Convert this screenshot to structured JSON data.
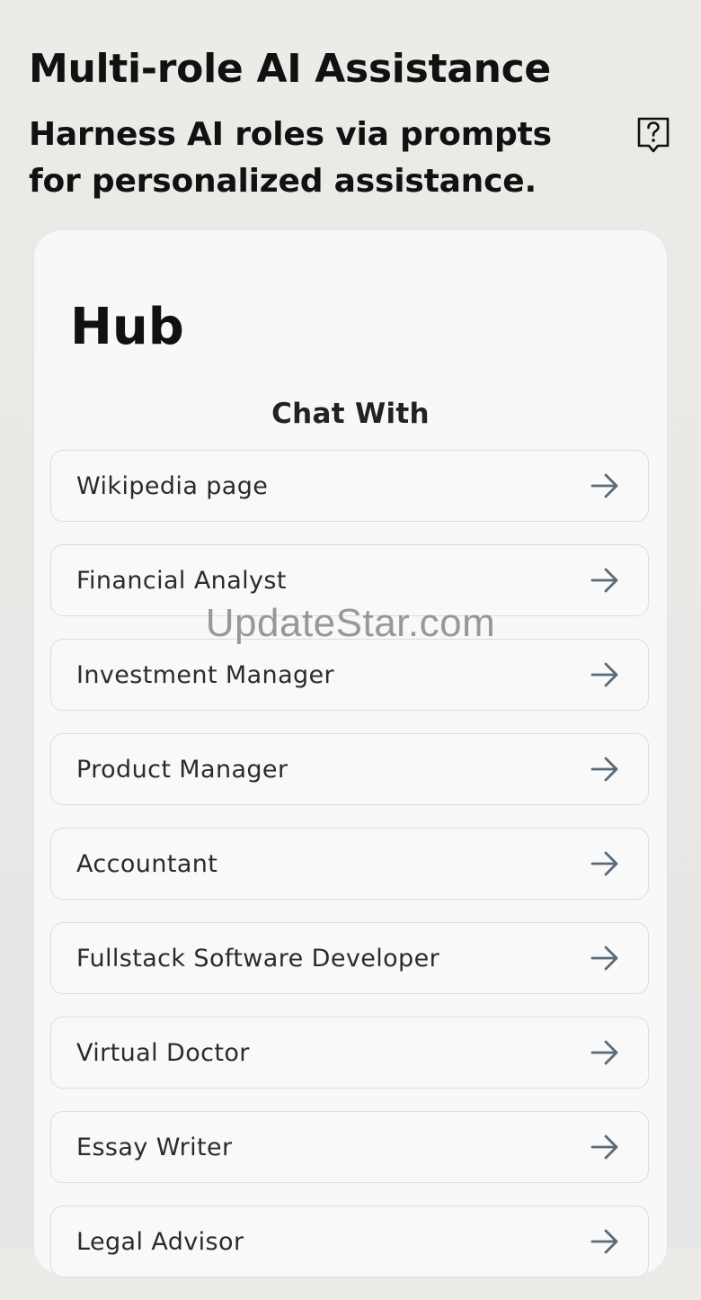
{
  "header": {
    "title": "Multi-role AI Assistance",
    "subtitle": "Harness AI roles via prompts for personalized assistance.",
    "help_icon": "help-bubble-question-icon"
  },
  "hub": {
    "title": "Hub",
    "section_label": "Chat With",
    "arrow_icon": "arrow-right-icon",
    "items": [
      {
        "label": "Wikipedia page"
      },
      {
        "label": "Financial Analyst"
      },
      {
        "label": "Investment Manager"
      },
      {
        "label": "Product Manager"
      },
      {
        "label": "Accountant"
      },
      {
        "label": "Fullstack Software Developer"
      },
      {
        "label": "Virtual Doctor"
      },
      {
        "label": "Essay Writer"
      },
      {
        "label": "Legal Advisor"
      }
    ]
  },
  "watermark": {
    "text": "UpdateStar.com"
  },
  "colors": {
    "background": "#ebeae7",
    "card": "#f8f8f8",
    "item_border": "#dddddd",
    "arrow": "#5a6a78",
    "text_primary": "#111111"
  }
}
